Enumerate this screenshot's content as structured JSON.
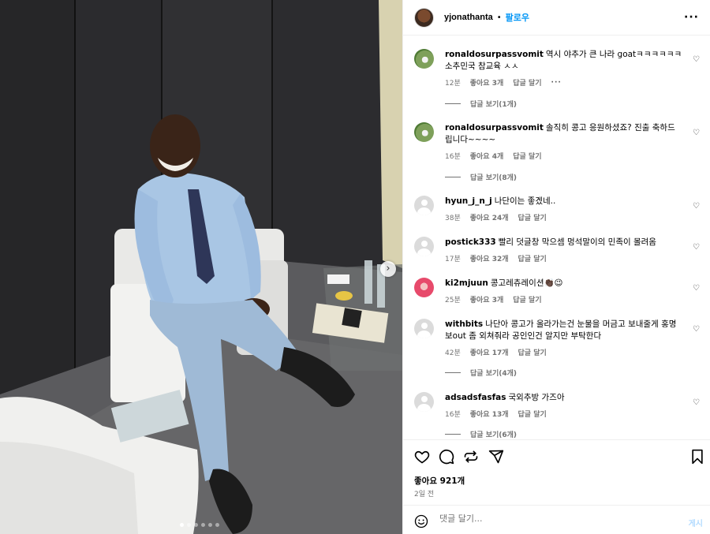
{
  "post": {
    "username": "yjonathanta",
    "separator": "•",
    "follow_label": "팔로우",
    "more_label": "···"
  },
  "photo": {
    "next_icon": "chevron-right-icon",
    "slide_count": 6,
    "active_slide": 1
  },
  "comments": [
    {
      "user": "ronaldosurpassvomit",
      "text": "역시 야추가 큰 나라 goatㅋㅋㅋㅋㅋㅋ 소추민국 참교육 ㅅㅅ",
      "time": "12분",
      "likes": "좋아요 3개",
      "reply": "답글 달기",
      "more": "···",
      "replies": "답글 보기(1개)",
      "avatar": "grass"
    },
    {
      "user": "ronaldosurpassvomit",
      "text": "솔직히 콩고 응원하셨죠? 진출 축하드립니다~~~~",
      "time": "16분",
      "likes": "좋아요 4개",
      "reply": "답글 달기",
      "replies": "답글 보기(8개)",
      "avatar": "grass"
    },
    {
      "user": "hyun_j_n_j",
      "text": "나단이는 좋겠네..",
      "time": "38분",
      "likes": "좋아요 24개",
      "reply": "답글 달기",
      "avatar": "default"
    },
    {
      "user": "postick333",
      "text": "빨리 덧글창 막으셈 멍석말이의 민족이 몰려옴",
      "time": "17분",
      "likes": "좋아요 32개",
      "reply": "답글 달기",
      "avatar": "default"
    },
    {
      "user": "ki2mjuun",
      "text": "콩고레츄레이션👏🏿😉",
      "time": "25분",
      "likes": "좋아요 3개",
      "reply": "답글 달기",
      "avatar": "pink"
    },
    {
      "user": "withbits",
      "text": "나단아 콩고가 올라가는건 눈물을 머금고 보내줄게 홍명보out 좀 외쳐줘라 공인인건 알지만 부탁한다",
      "time": "42분",
      "likes": "좋아요 17개",
      "reply": "답글 달기",
      "replies": "답글 보기(4개)",
      "avatar": "default"
    },
    {
      "user": "adsadsfasfas",
      "text": "국외추방 가즈아",
      "time": "16분",
      "likes": "좋아요 13개",
      "reply": "답글 달기",
      "replies": "답글 보기(6개)",
      "avatar": "default"
    }
  ],
  "actions": {
    "icons": [
      "heart-icon",
      "comment-icon",
      "repost-icon",
      "share-icon",
      "bookmark-icon"
    ],
    "likes_text": "좋아요 921개",
    "date_text": "2일 전"
  },
  "add_comment": {
    "placeholder": "댓글 달기...",
    "post_label": "게시"
  }
}
